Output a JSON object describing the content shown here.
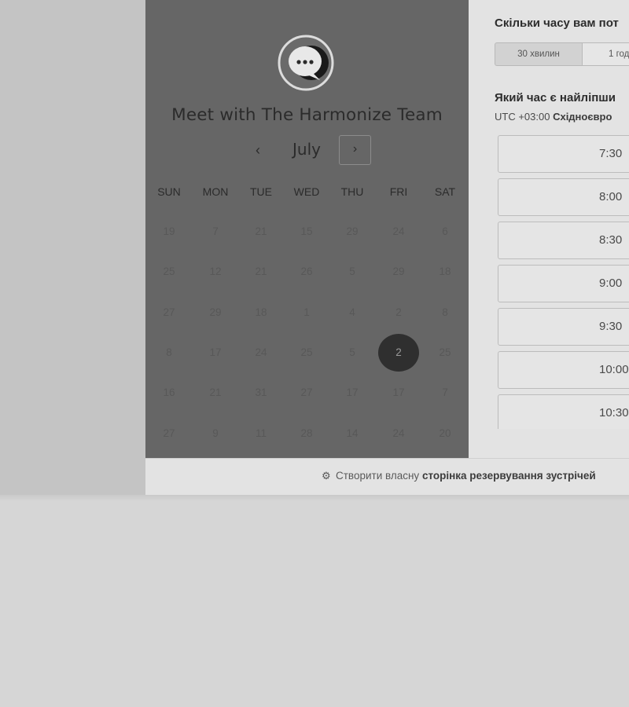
{
  "meeting": {
    "title": "Meet with The Harmonize Team",
    "avatar_icon": "chat-bubble-icon"
  },
  "calendar": {
    "month": "July",
    "prev_icon": "chevron-left-icon",
    "next_icon": "chevron-right-icon",
    "weekdays": [
      "SUN",
      "MON",
      "TUE",
      "WED",
      "THU",
      "FRI",
      "SAT"
    ],
    "weeks": [
      [
        "19",
        "7",
        "21",
        "15",
        "29",
        "24",
        "6"
      ],
      [
        "25",
        "12",
        "21",
        "26",
        "5",
        "29",
        "18"
      ],
      [
        "27",
        "29",
        "18",
        "1",
        "4",
        "2",
        "8"
      ],
      [
        "8",
        "17",
        "24",
        "25",
        "5",
        "2",
        "25"
      ],
      [
        "16",
        "21",
        "31",
        "27",
        "17",
        "17",
        "7"
      ],
      [
        "27",
        "9",
        "11",
        "28",
        "14",
        "24",
        "20"
      ]
    ],
    "selected_day": "2"
  },
  "duration": {
    "question": "Скільки часу вам пот",
    "options": [
      {
        "label": "30 хвилин",
        "selected": true
      },
      {
        "label": "1 год",
        "selected": false
      }
    ]
  },
  "time_slots": {
    "question": "Який час є найліпши",
    "timezone_prefix": "UTC +03:00",
    "timezone_name": "Східноєвро",
    "slots": [
      "7:30",
      "8:00",
      "8:30",
      "9:00",
      "9:30",
      "10:00",
      "10:30"
    ]
  },
  "footer": {
    "icon": "hubspot-sprocket-icon",
    "text_prefix": "Створити власну",
    "text_bold": "сторінка резервування зустрічей"
  },
  "colors": {
    "left_panel": "#666666",
    "right_panel": "#e3e3e3",
    "selected_day_bg": "#2f2f2f"
  }
}
